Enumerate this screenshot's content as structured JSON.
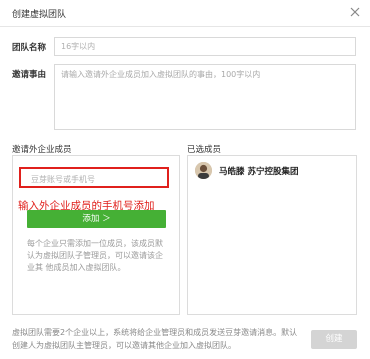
{
  "window": {
    "title": "创建虚拟团队"
  },
  "form": {
    "name_label": "团队名称",
    "name_placeholder": "16字以内",
    "reason_label": "邀请事由",
    "reason_placeholder": "请输入邀请外企业成员加入虚拟团队的事由，100字以内"
  },
  "invite": {
    "section_label": "邀请外企业成员",
    "search_placeholder": "豆芽账号或手机号",
    "annotation": "输入外企业成员的手机号添加",
    "add_button": "添加 ＞",
    "hint": "每个企业只需添加一位成员，该成员默认为虚拟团队子管理员，可以邀请该企业其 他成员加入虚拟团队。"
  },
  "selected": {
    "section_label": "已选成员",
    "members": [
      {
        "name": "马皓滕 苏宁控股集团"
      }
    ]
  },
  "footer": {
    "note": "虚拟团队需要2个企业以上，系统将给企业管理员和成员发送豆芽邀请消息。默认创建人为虚拟团队主管理员，可以邀请其他企业加入虚拟团队。",
    "create_button": "创建"
  },
  "colors": {
    "accent_green": "#45b035",
    "annotation_red": "#e0201c",
    "disabled_button": "#d4d4d4"
  },
  "icons": {
    "close": "close-icon",
    "chevron": "chevron-right-icon"
  }
}
